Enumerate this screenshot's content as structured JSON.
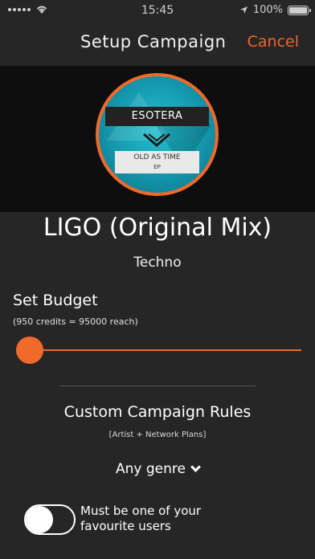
{
  "status_bar": {
    "time": "15:45",
    "battery_text": "100%"
  },
  "nav": {
    "title": "Setup Campaign",
    "cancel_label": "Cancel"
  },
  "artwork": {
    "artist": "ESOTERA",
    "album": "OLD AS TIME",
    "album_suffix": "EP"
  },
  "track": {
    "title": "LIGO (Original Mix)",
    "genre": "Techno"
  },
  "budget": {
    "label": "Set Budget",
    "subtitle": "(950 credits = 95000 reach)",
    "slider_fraction": 0.0
  },
  "rules": {
    "title": "Custom Campaign Rules",
    "subtitle": "[Artist + Network Plans]",
    "genre_option": "Any genre",
    "favourite_toggle_on": false,
    "favourite_label_line1": "Must be one of your",
    "favourite_label_line2": "favourite users"
  },
  "colors": {
    "accent": "#f06a2a",
    "background": "#262626"
  }
}
